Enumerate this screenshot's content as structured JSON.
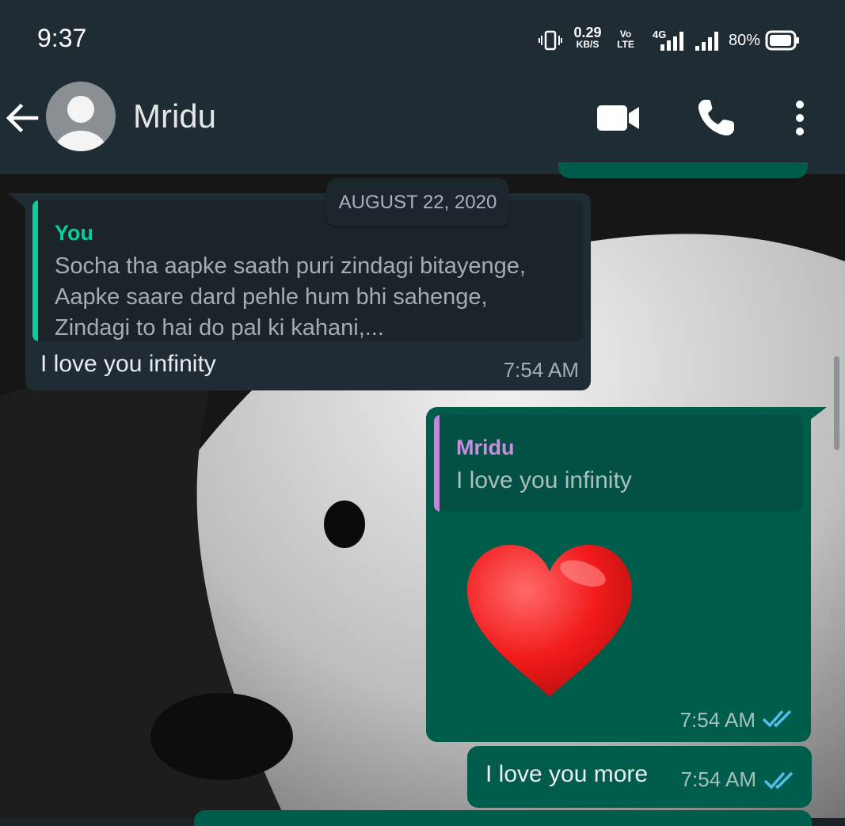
{
  "status_bar": {
    "time": "9:37",
    "net_speed_value": "0.29",
    "net_speed_unit": "KB/S",
    "volte_top": "Vo",
    "volte_bottom": "LTE",
    "network_label": "4G",
    "battery": "80%",
    "icons": [
      "vibrate-icon",
      "signal-4g-icon",
      "signal-icon",
      "battery-icon"
    ]
  },
  "app_bar": {
    "contact_name": "Mridu",
    "icons": [
      "back-arrow-icon",
      "avatar-placeholder",
      "video-call-icon",
      "phone-icon",
      "more-vert-icon"
    ]
  },
  "date_chip": "AUGUST 22, 2020",
  "messages": [
    {
      "direction": "incoming",
      "quote_author": "You",
      "quote_text": "Socha tha aapke saath puri zindagi bitayenge,\nAapke saare dard pehle hum bhi sahenge,\nZindagi to hai do pal ki kahani,...",
      "text": "I love you infinity",
      "time": "7:54 AM"
    },
    {
      "direction": "outgoing",
      "quote_author": "Mridu",
      "quote_text": "I love you infinity",
      "emoji": "red-heart",
      "time": "7:54 AM",
      "status": "read"
    },
    {
      "direction": "outgoing",
      "text": "I love you more",
      "time": "7:54 AM",
      "status": "read"
    }
  ],
  "colors": {
    "header": "#1f2c34",
    "incoming_bubble": "#1f2c34",
    "outgoing_bubble": "#005c4b",
    "quote_bar_you": "#06cf9c",
    "quote_bar_contact": "#c088d6",
    "read_ticks": "#53bdeb"
  }
}
